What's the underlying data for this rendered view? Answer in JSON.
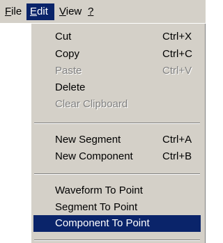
{
  "menubar": {
    "items": [
      {
        "mnemonic": "F",
        "rest": "ile"
      },
      {
        "mnemonic": "E",
        "rest": "dit"
      },
      {
        "mnemonic": "V",
        "rest": "iew"
      },
      {
        "mnemonic": "?",
        "rest": ""
      }
    ],
    "active_index": 1
  },
  "edit_menu": {
    "cut": {
      "label": "Cut",
      "shortcut": "Ctrl+X",
      "enabled": true
    },
    "copy": {
      "label": "Copy",
      "shortcut": "Ctrl+C",
      "enabled": true
    },
    "paste": {
      "label": "Paste",
      "shortcut": "Ctrl+V",
      "enabled": false
    },
    "delete": {
      "label": "Delete",
      "shortcut": "",
      "enabled": true
    },
    "clear_clipboard": {
      "label": "Clear Clipboard",
      "shortcut": "",
      "enabled": false
    },
    "new_segment": {
      "label": "New Segment",
      "shortcut": "Ctrl+A",
      "enabled": true
    },
    "new_component": {
      "label": "New Component",
      "shortcut": "Ctrl+B",
      "enabled": true
    },
    "waveform_to_point": {
      "label": "Waveform To Point",
      "enabled": true
    },
    "segment_to_point": {
      "label": "Segment To Point",
      "enabled": true
    },
    "component_to_point": {
      "label": "Component To Point",
      "enabled": true,
      "highlighted": true
    }
  },
  "colors": {
    "face": "#d4d0c8",
    "highlight": "#0a246a",
    "disabled_text": "#808080"
  }
}
